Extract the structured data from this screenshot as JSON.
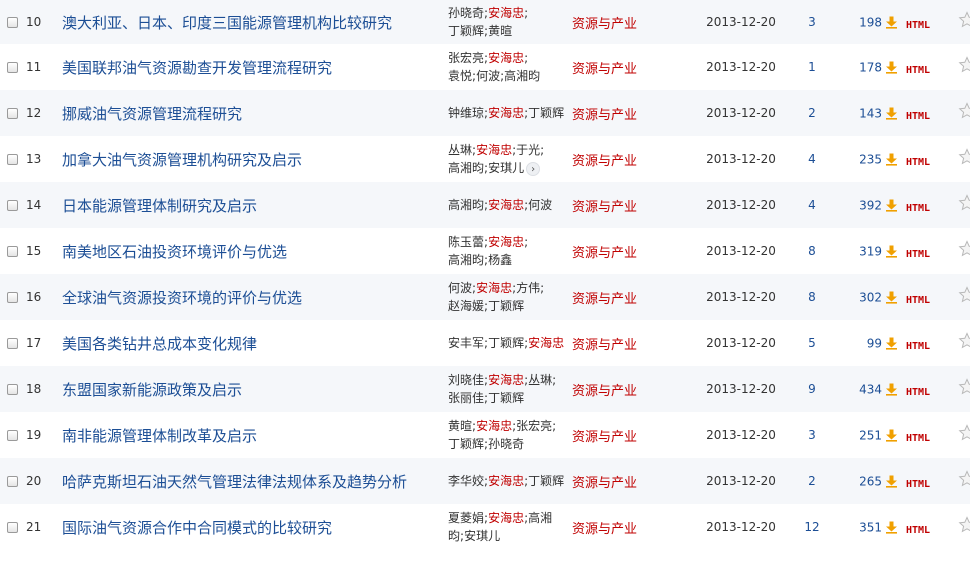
{
  "icons": {
    "download": "download-arrow-icon",
    "favorite": "star-outline-icon",
    "more": "chevron-right-icon"
  },
  "colors": {
    "title_link": "#1c4e95",
    "highlight_author": "#c00000",
    "source": "#c00000",
    "download_arrow": "#f0a000",
    "row_alt": "#f5f7fa"
  },
  "rows": [
    {
      "num": "10",
      "title": "澳大利亚、日本、印度三国能源管理机构比较研究",
      "authors": [
        {
          "name": "孙晓奇",
          "hl": false,
          "sep": ";"
        },
        {
          "name": "安海忠",
          "hl": true,
          "sep": ";"
        },
        {
          "name": "丁颖",
          "hl": false,
          "sep": ""
        },
        {
          "name": "辉",
          "hl": false,
          "sep": ";"
        },
        {
          "name": "黄暄",
          "hl": false,
          "sep": ""
        }
      ],
      "breaks": [
        2
      ],
      "more": false,
      "source": "资源与产业",
      "date": "2013-12-20",
      "cited": "3",
      "downloads": "198",
      "html": "HTML"
    },
    {
      "num": "11",
      "title": "美国联邦油气资源勘查开发管理流程研究",
      "authors": [
        {
          "name": "张宏亮",
          "hl": false,
          "sep": ";"
        },
        {
          "name": "安海忠",
          "hl": true,
          "sep": ";"
        },
        {
          "name": "袁悦",
          "hl": false,
          "sep": ";"
        },
        {
          "name": "何波",
          "hl": false,
          "sep": ";"
        },
        {
          "name": "高湘昀",
          "hl": false,
          "sep": ""
        }
      ],
      "breaks": [
        2
      ],
      "more": false,
      "source": "资源与产业",
      "date": "2013-12-20",
      "cited": "1",
      "downloads": "178",
      "html": "HTML"
    },
    {
      "num": "12",
      "title": "挪威油气资源管理流程研究",
      "authors": [
        {
          "name": "钟维琼",
          "hl": false,
          "sep": ";"
        },
        {
          "name": "安海忠",
          "hl": true,
          "sep": ";"
        },
        {
          "name": "丁颖辉",
          "hl": false,
          "sep": ""
        }
      ],
      "breaks": [],
      "more": false,
      "source": "资源与产业",
      "date": "2013-12-20",
      "cited": "2",
      "downloads": "143",
      "html": "HTML"
    },
    {
      "num": "13",
      "title": "加拿大油气资源管理机构研究及启示",
      "authors": [
        {
          "name": "丛琳",
          "hl": false,
          "sep": ";"
        },
        {
          "name": "安海忠",
          "hl": true,
          "sep": ";"
        },
        {
          "name": "于光",
          "hl": false,
          "sep": ";"
        },
        {
          "name": "高湘",
          "hl": false,
          "sep": ""
        },
        {
          "name": "昀",
          "hl": false,
          "sep": ";"
        },
        {
          "name": "安琪儿",
          "hl": false,
          "sep": ""
        }
      ],
      "breaks": [
        3
      ],
      "more": true,
      "source": "资源与产业",
      "date": "2013-12-20",
      "cited": "4",
      "downloads": "235",
      "html": "HTML"
    },
    {
      "num": "14",
      "title": "日本能源管理体制研究及启示",
      "authors": [
        {
          "name": "高湘昀",
          "hl": false,
          "sep": ";"
        },
        {
          "name": "安海忠",
          "hl": true,
          "sep": ";"
        },
        {
          "name": "何波",
          "hl": false,
          "sep": ""
        }
      ],
      "breaks": [],
      "more": false,
      "source": "资源与产业",
      "date": "2013-12-20",
      "cited": "4",
      "downloads": "392",
      "html": "HTML"
    },
    {
      "num": "15",
      "title": "南美地区石油投资环境评价与优选",
      "authors": [
        {
          "name": "陈玉蕾",
          "hl": false,
          "sep": ";"
        },
        {
          "name": "安海忠",
          "hl": true,
          "sep": ";"
        },
        {
          "name": "高湘",
          "hl": false,
          "sep": ""
        },
        {
          "name": "昀",
          "hl": false,
          "sep": ";"
        },
        {
          "name": "杨鑫",
          "hl": false,
          "sep": ""
        }
      ],
      "breaks": [
        2
      ],
      "more": false,
      "source": "资源与产业",
      "date": "2013-12-20",
      "cited": "8",
      "downloads": "319",
      "html": "HTML"
    },
    {
      "num": "16",
      "title": "全球油气资源投资环境的评价与优选",
      "authors": [
        {
          "name": "何波",
          "hl": false,
          "sep": ";"
        },
        {
          "name": "安海忠",
          "hl": true,
          "sep": ";"
        },
        {
          "name": "方伟",
          "hl": false,
          "sep": ";"
        },
        {
          "name": "赵",
          "hl": false,
          "sep": ""
        },
        {
          "name": "海媛",
          "hl": false,
          "sep": ";"
        },
        {
          "name": "丁颖辉",
          "hl": false,
          "sep": ""
        }
      ],
      "breaks": [
        3
      ],
      "more": false,
      "source": "资源与产业",
      "date": "2013-12-20",
      "cited": "8",
      "downloads": "302",
      "html": "HTML"
    },
    {
      "num": "17",
      "title": "美国各类钻井总成本变化规律",
      "authors": [
        {
          "name": "安丰军",
          "hl": false,
          "sep": ";"
        },
        {
          "name": "丁颖辉",
          "hl": false,
          "sep": ";"
        },
        {
          "name": "安海忠",
          "hl": true,
          "sep": ""
        }
      ],
      "breaks": [],
      "more": false,
      "source": "资源与产业",
      "date": "2013-12-20",
      "cited": "5",
      "downloads": "99",
      "html": "HTML"
    },
    {
      "num": "18",
      "title": "东盟国家新能源政策及启示",
      "authors": [
        {
          "name": "刘晓佳",
          "hl": false,
          "sep": ";"
        },
        {
          "name": "安海忠",
          "hl": true,
          "sep": ";"
        },
        {
          "name": "丛琳",
          "hl": false,
          "sep": ";"
        },
        {
          "name": "张丽佳",
          "hl": false,
          "sep": ";"
        },
        {
          "name": "丁颖辉",
          "hl": false,
          "sep": ""
        }
      ],
      "breaks": [
        3
      ],
      "more": false,
      "source": "资源与产业",
      "date": "2013-12-20",
      "cited": "9",
      "downloads": "434",
      "html": "HTML"
    },
    {
      "num": "19",
      "title": "南非能源管理体制改革及启示",
      "authors": [
        {
          "name": "黄暄",
          "hl": false,
          "sep": ";"
        },
        {
          "name": "安海忠",
          "hl": true,
          "sep": ";"
        },
        {
          "name": "张宏亮",
          "hl": false,
          "sep": ";"
        },
        {
          "name": "丁颖辉",
          "hl": false,
          "sep": ";"
        },
        {
          "name": "孙晓奇",
          "hl": false,
          "sep": ""
        }
      ],
      "breaks": [
        3
      ],
      "more": false,
      "source": "资源与产业",
      "date": "2013-12-20",
      "cited": "3",
      "downloads": "251",
      "html": "HTML"
    },
    {
      "num": "20",
      "title": "哈萨克斯坦石油天然气管理法律法规体系及趋势分析",
      "authors": [
        {
          "name": "李华姣",
          "hl": false,
          "sep": ";"
        },
        {
          "name": "安海忠",
          "hl": true,
          "sep": ";"
        },
        {
          "name": "丁颖辉",
          "hl": false,
          "sep": ""
        }
      ],
      "breaks": [],
      "more": false,
      "source": "资源与产业",
      "date": "2013-12-20",
      "cited": "2",
      "downloads": "265",
      "html": "HTML"
    },
    {
      "num": "21",
      "title": "国际油气资源合作中合同模式的比较研究",
      "authors": [
        {
          "name": "夏菱娟",
          "hl": false,
          "sep": ";"
        },
        {
          "name": "安海忠",
          "hl": true,
          "sep": ";"
        },
        {
          "name": "高湘",
          "hl": false,
          "sep": ""
        },
        {
          "name": "昀",
          "hl": false,
          "sep": ";"
        },
        {
          "name": "安琪儿",
          "hl": false,
          "sep": ""
        }
      ],
      "breaks": [
        3
      ],
      "more": false,
      "source": "资源与产业",
      "date": "2013-12-20",
      "cited": "12",
      "downloads": "351",
      "html": "HTML"
    }
  ]
}
